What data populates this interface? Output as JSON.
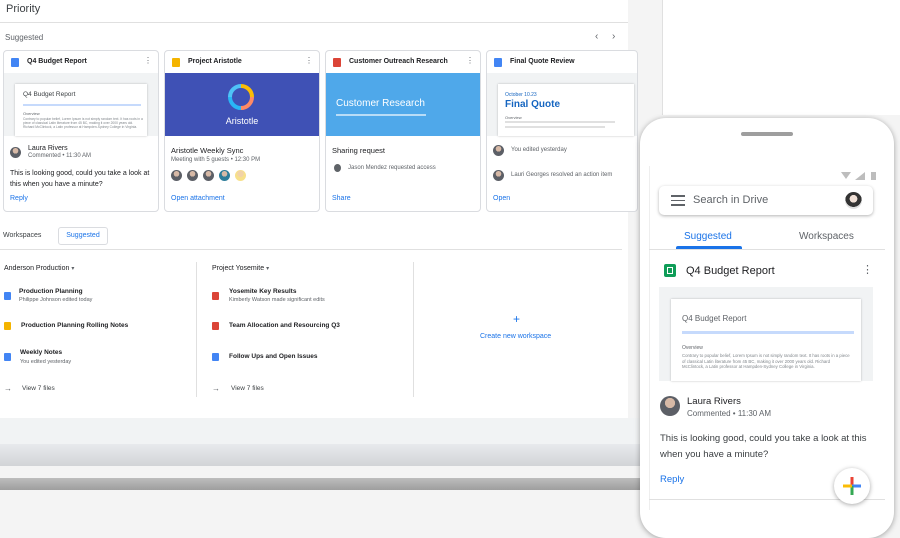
{
  "header": {
    "title": "Priority",
    "suggested_label": "Suggested",
    "prev": "‹",
    "next": "›"
  },
  "cards": [
    {
      "title": "Q4 Budget Report",
      "icon_color": "#4285f4",
      "preview_title": "Q4 Budget Report",
      "preview_sub": "Overview",
      "preview_text": "Contrary to popular belief, Lorem Ipsum is not simply random text. It has roots in a piece of classical Latin literature from 45 BC, making it over 2000 years old. Richard McClintock, a Latin professor at Hampden-Sydney College in Virginia.",
      "person": "Laura Rivers",
      "meta": "Commented • 11:30 AM",
      "comment": "This is looking good, could you take a look at this when you have a minute?",
      "action": "Reply"
    },
    {
      "title": "Project Aristotle",
      "icon_color": "#f4b400",
      "banner_text": "Aristotle",
      "banner_color": "#3f51b5",
      "event": "Aristotle Weekly Sync",
      "event_meta": "Meeting with 5 guests • 12:30 PM",
      "action": "Open attachment"
    },
    {
      "title": "Customer Outreach Research",
      "icon_color": "#db4437",
      "banner_text": "Customer Research",
      "banner_color": "#4fa8ea",
      "heading": "Sharing request",
      "activity": "Jason Mendez requested access",
      "action": "Share"
    },
    {
      "title": "Final Quote Review",
      "icon_color": "#4285f4",
      "preview_date": "October 10.23",
      "preview_title": "Final Quote",
      "preview_sub": "Overview",
      "activity1": "You edited yesterday",
      "activity2": "Lauri Georges resolved an action item",
      "action": "Open"
    }
  ],
  "workspaces": {
    "label": "Workspaces",
    "tab": "Suggested",
    "columns": [
      {
        "name": "Anderson Production",
        "files": [
          {
            "title": "Production Planning",
            "sub": "Philippe Johnson edited today",
            "icon_color": "#4285f4"
          },
          {
            "title": "Production Planning Rolling Notes",
            "sub": "",
            "icon_color": "#f4b400"
          },
          {
            "title": "Weekly Notes",
            "sub": "You edited yesterday",
            "icon_color": "#4285f4"
          }
        ],
        "view_all": "View 7 files"
      },
      {
        "name": "Project Yosemite",
        "files": [
          {
            "title": "Yosemite Key Results",
            "sub": "Kimberly Watson made significant edits",
            "icon_color": "#db4437"
          },
          {
            "title": "Team Allocation and Resourcing Q3",
            "sub": "",
            "icon_color": "#db4437"
          },
          {
            "title": "Follow Ups and Open Issues",
            "sub": "",
            "icon_color": "#4285f4"
          }
        ],
        "view_all": "View 7 files"
      }
    ],
    "create": {
      "icon": "+",
      "label": "Create new workspace"
    }
  },
  "phone": {
    "search_placeholder": "Search in Drive",
    "tabs": [
      "Suggested",
      "Workspaces"
    ],
    "card": {
      "title": "Q4 Budget Report",
      "preview_title": "Q4 Budget Report",
      "preview_sub": "Overview",
      "preview_text": "Contrary to popular belief, Lorem Ipsum is not simply random text. It has roots in a piece of classical Latin literature from 45 BC, making it over 2000 years old. Richard McClintock, a Latin professor at Hampden-Sydney College in Virginia.",
      "person": "Laura Rivers",
      "meta": "Commented • 11:30 AM",
      "comment": "This is looking good, could you take a look at this when you have a minute?",
      "action": "Reply"
    }
  },
  "colors": {
    "accent": "#1a73e8",
    "sheets_green": "#0f9d58"
  }
}
